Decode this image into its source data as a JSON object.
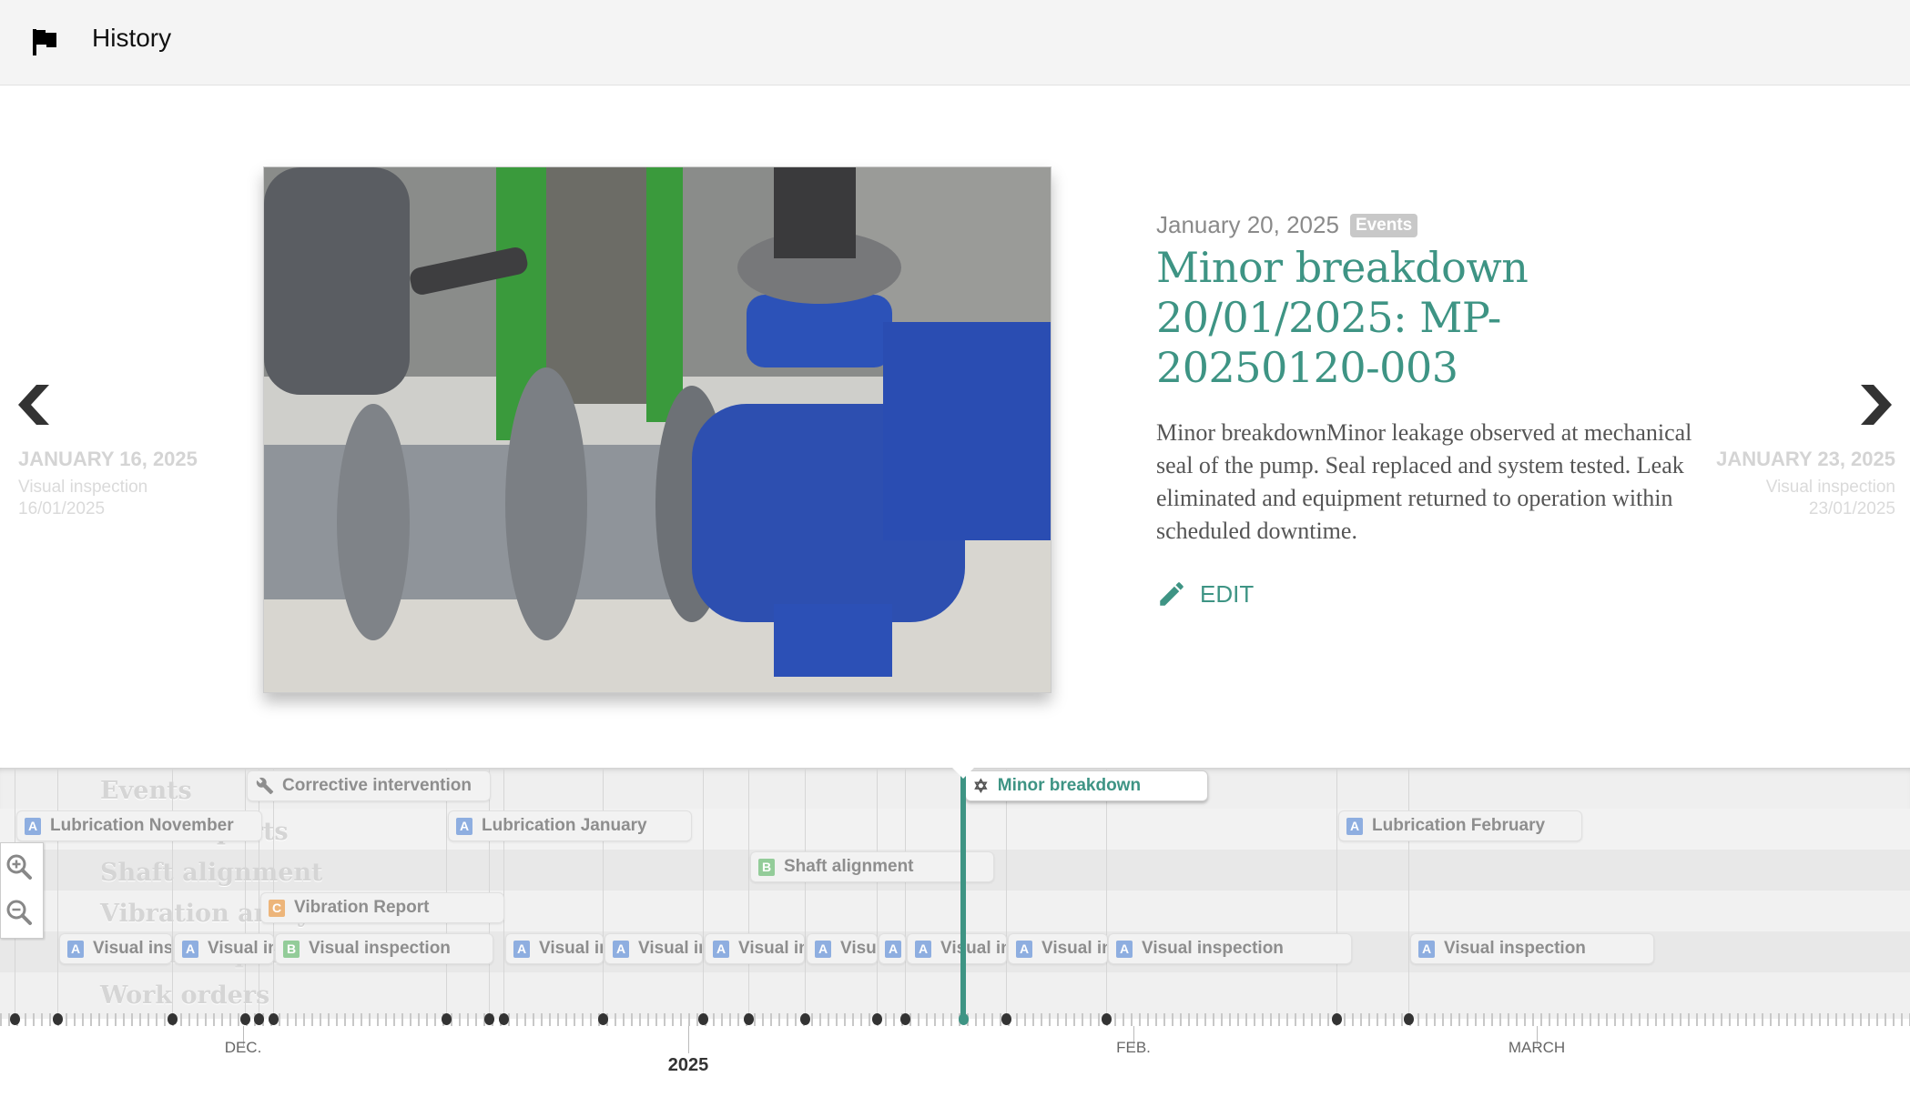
{
  "header": {
    "title": "History",
    "icon": "flag-icon"
  },
  "navigation": {
    "prev": {
      "date": "JANUARY 16, 2025",
      "title": "Visual inspection 16/01/2025"
    },
    "next": {
      "date": "JANUARY 23, 2025",
      "title": "Visual inspection 23/01/2025"
    }
  },
  "slide": {
    "date": "January 20, 2025",
    "badge": "Events",
    "title": "Minor breakdown 20/01/2025: MP-20250120-003",
    "description": "Minor breakdownMinor leakage observed at mechanical seal of the pump. Seal replaced and system tested. Leak eliminated and equipment returned to operation within scheduled downtime.",
    "edit_label": "EDIT",
    "image_alt": "Blue centrifugal pump with grey PVC pipes and valve",
    "accent_color": "#3e9484"
  },
  "timeline": {
    "groups": [
      "Events",
      "Other reports",
      "Shaft alignment",
      "Vibration analysis",
      "Visual inspection",
      "Work orders"
    ],
    "markers": {
      "corrective": {
        "label": "Corrective intervention",
        "icon": "wrench-icon"
      },
      "minor": {
        "label": "Minor breakdown",
        "icon": "star-icon"
      },
      "lub_nov": {
        "label": "Lubrication November",
        "tag": "A"
      },
      "lub_jan": {
        "label": "Lubrication January",
        "tag": "A"
      },
      "lub_feb": {
        "label": "Lubrication February",
        "tag": "A"
      },
      "shaft": {
        "label": "Shaft alignment",
        "tag": "B"
      },
      "vib": {
        "label": "Vibration Report",
        "tag": "C"
      },
      "vi_1": {
        "label": "Visual inspection",
        "tag": "A"
      },
      "vi_2": {
        "label": "Visual inspection",
        "tag": "A"
      },
      "vi_3": {
        "label": "Visual inspection",
        "tag": "B"
      },
      "vi_4": {
        "label": "Visual inspection",
        "tag": "A"
      },
      "vi_5": {
        "label": "Visual inspection",
        "tag": "A"
      },
      "vi_6": {
        "label": "Visual inspection",
        "tag": "A"
      },
      "vi_7": {
        "label": "Visual inspection",
        "tag": "A"
      },
      "vi_8": {
        "label": "Visual inspection",
        "tag": "A"
      },
      "vi_9": {
        "label": "Visual inspection",
        "tag": "A"
      },
      "vi_10": {
        "label": "Visual inspection",
        "tag": "A"
      },
      "vi_11": {
        "label": "Visual inspection",
        "tag": "A"
      },
      "vi_12": {
        "label": "Visual inspection",
        "tag": "A"
      }
    },
    "axis_labels": {
      "dec": "DEC.",
      "year": "2025",
      "feb": "FEB.",
      "march": "MARCH"
    },
    "current_event": "Minor breakdown"
  }
}
